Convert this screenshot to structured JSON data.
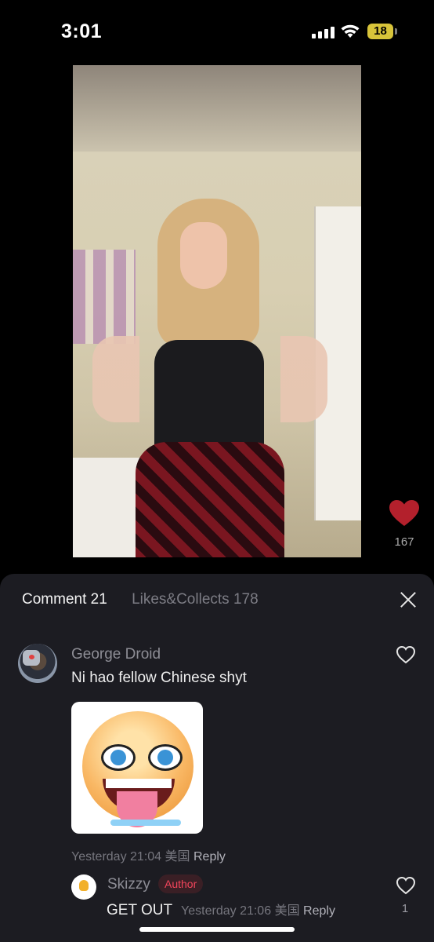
{
  "status_bar": {
    "time": "3:01",
    "battery": "18"
  },
  "post": {
    "like_count": "167"
  },
  "comments_panel": {
    "tabs": [
      {
        "label": "Comment 21",
        "active": true
      },
      {
        "label": "Likes&Collects 178",
        "active": false
      }
    ],
    "comments": [
      {
        "username": "George Droid",
        "text": "Ni hao fellow Chinese shyt",
        "timestamp": "Yesterday 21:04",
        "location": "美国",
        "reply_label": "Reply",
        "replies": [
          {
            "username": "Skizzy",
            "badge": "Author",
            "text": "GET OUT",
            "timestamp": "Yesterday 21:06",
            "location": "美国",
            "reply_label": "Reply",
            "like_count": "1"
          }
        ]
      }
    ]
  },
  "colors": {
    "sheet_bg": "#1c1c22",
    "like_heart": "#b3202c",
    "author_badge": "#f2455b"
  }
}
